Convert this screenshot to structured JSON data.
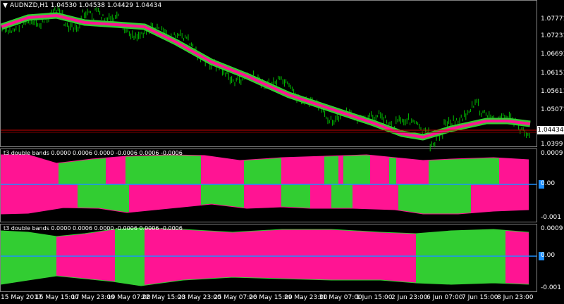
{
  "header": {
    "menu_glyph": "▼",
    "symbol_info": "AUDNZD,H1  1.04530 1.04538 1.04429 1.04434"
  },
  "main_chart": {
    "price_labels": [
      "1.07771",
      "1.07231",
      "1.06691",
      "1.06151",
      "1.05611",
      "1.05071",
      "1.0399"
    ],
    "current_price": "1.04434"
  },
  "indicator1": {
    "title": "t3 double bands 0.0000 0.0006 0.0000 -0.0006 0.0006 -0.0006",
    "labels": [
      "0.0009",
      "0.00",
      "-0.001"
    ]
  },
  "indicator2": {
    "title": "t3 double bands 0.0000 0.0006 0.0000 -0.0006 0.0006 -0.0006",
    "labels": [
      "0.0009",
      "0.00",
      "-0.001"
    ]
  },
  "time_axis": [
    "15 May 2017",
    "16 May 15:00",
    "17 May 23:00",
    "19 May 07:00",
    "22 May 15:00",
    "23 May 23:00",
    "25 May 07:00",
    "26 May 15:00",
    "29 May 23:00",
    "31 May 07:00",
    "1 Jun 15:00",
    "2 Jun 23:00",
    "6 Jun 07:00",
    "7 Jun 15:00",
    "8 Jun 23:00"
  ],
  "colors": {
    "background": "#000000",
    "price_bar": "#00c000",
    "band_green": "#32cd32",
    "band_pink": "#ff1493",
    "zero_line": "#1e90ff",
    "current_price_line": "#cc0000"
  }
}
